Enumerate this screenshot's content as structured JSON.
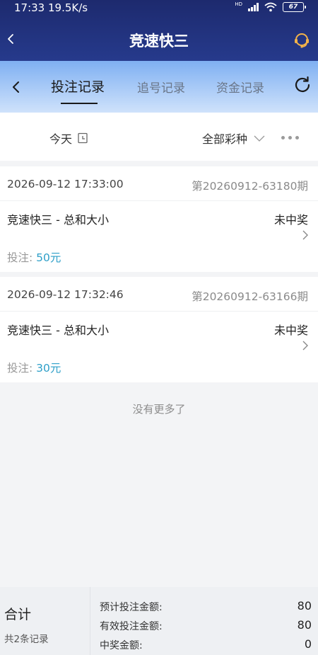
{
  "status_bar": {
    "time": "17:33 19.5K/s",
    "network": "HD",
    "battery": "67"
  },
  "nav": {
    "title": "竞速快三"
  },
  "tabs": [
    {
      "label": "投注记录",
      "active": true
    },
    {
      "label": "追号记录",
      "active": false
    },
    {
      "label": "资金记录",
      "active": false
    }
  ],
  "filter": {
    "date": "今天",
    "lottery": "全部彩种"
  },
  "records": [
    {
      "time": "2026-09-12 17:33:00",
      "issue": "第20260912-63180期",
      "name": "竞速快三 - 总和大小",
      "status": "未中奖",
      "bet_label": "投注: ",
      "bet_amount": "50元"
    },
    {
      "time": "2026-09-12 17:32:46",
      "issue": "第20260912-63166期",
      "name": "竞速快三 - 总和大小",
      "status": "未中奖",
      "bet_label": "投注: ",
      "bet_amount": "30元"
    }
  ],
  "no_more": "没有更多了",
  "summary": {
    "title": "合计",
    "count": "共2条记录",
    "rows": [
      {
        "label": "预计投注金额:",
        "value": "80"
      },
      {
        "label": "有效投注金额:",
        "value": "80"
      },
      {
        "label": "中奖金额:",
        "value": "0"
      }
    ]
  },
  "colors": {
    "header_dark": "#1d2a6e",
    "tab_gradient_top": "#7fb0f2",
    "bet_amount": "#2e9fc8"
  }
}
